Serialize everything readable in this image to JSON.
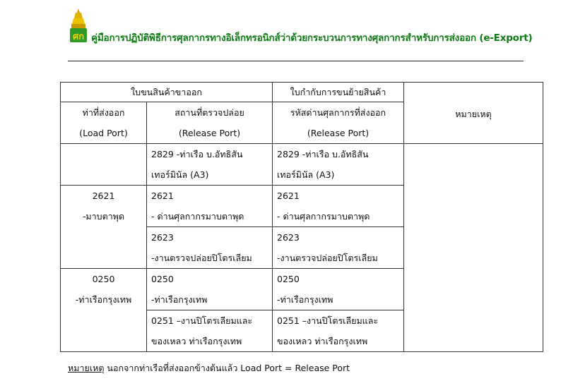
{
  "header": {
    "logo_icon": "royal-crest-icon",
    "title": "คู่มือการปฏิบัติพิธีการศุลกากรทางอิเล็กทรอนิกส์ว่าด้วยกระบวนการทางศุลกากรสำหรับการส่งออก (e-Export)",
    "title_color": "#0f7a16"
  },
  "table": {
    "group_export": "ใบขนสินค้าขาออก",
    "group_transfer": "ใบกำกับการขนย้ายสินค้า",
    "col_remark": "หมายเหตุ",
    "col_load_port": {
      "line1": "ท่าที่ส่งออก",
      "line2": "(Load Port)"
    },
    "col_release_port": {
      "line1": "สถานที่ตรวจปล่อย",
      "line2": "(Release Port)"
    },
    "col_customs_code": {
      "line1": "รหัสด่านศุลกากรที่ส่งออก",
      "line2": "(Release Port)"
    },
    "rows": [
      {
        "load_port": {
          "line1": "",
          "line2": ""
        },
        "subrows": [
          {
            "line1": "2829  -ท่าเรือ บ.อัทธิสัน",
            "line2": "เทอร์มินัล (A3)"
          }
        ]
      },
      {
        "load_port": {
          "line1": "2621",
          "line2": "-มาบตาพุด"
        },
        "subrows": [
          {
            "line1": "2621",
            "line2": "- ด่านศุลกากรมาบตาพุด"
          },
          {
            "line1": "2623",
            "line2": "-งานตรวจปล่อยปิโตรเลียม"
          }
        ]
      },
      {
        "load_port": {
          "line1": "0250",
          "line2": "-ท่าเรือกรุงเทพ"
        },
        "subrows": [
          {
            "line1": "0250",
            "line2": "-ท่าเรือกรุงเทพ"
          },
          {
            "line1": "0251 –งานปิโตรเลียมและ",
            "line2": "ของเหลว ท่าเรือกรุงเทพ"
          }
        ]
      }
    ]
  },
  "footnote": {
    "label": "หมายเหตุ",
    "text": " นอกจากท่าเรือที่ส่งออกข้างต้นแล้ว Load Port = Release Port"
  }
}
